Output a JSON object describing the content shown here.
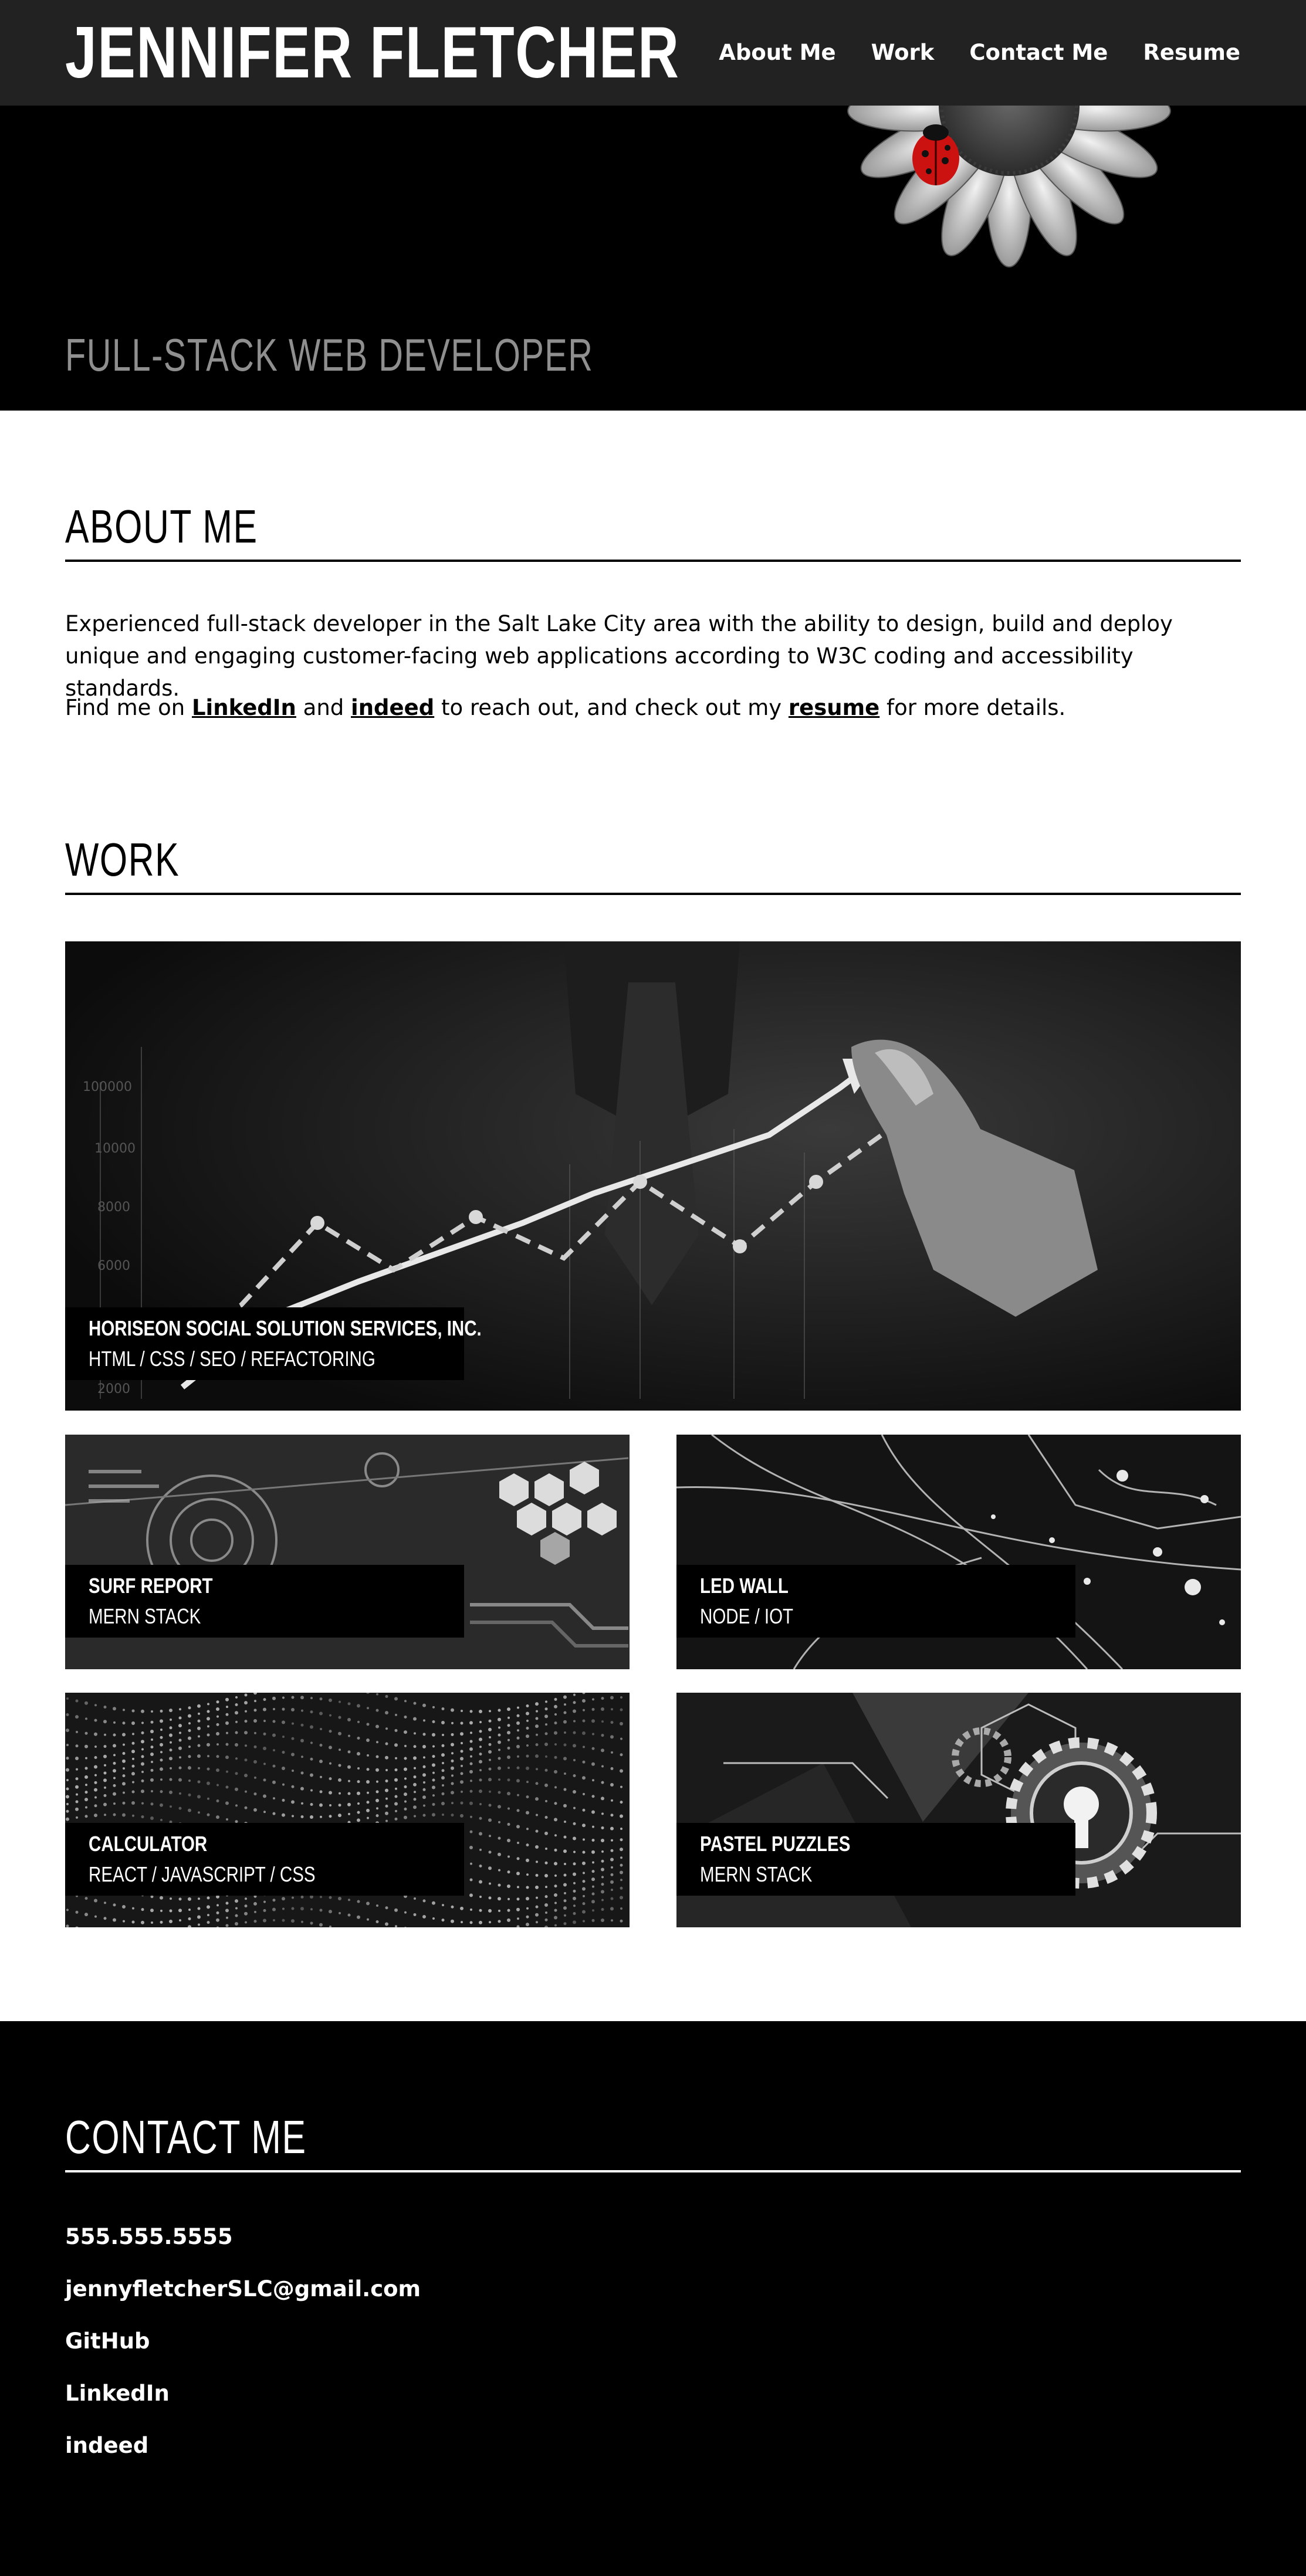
{
  "header": {
    "site_title": "JENNIFER FLETCHER",
    "nav": [
      "About Me",
      "Work",
      "Contact Me",
      "Resume"
    ]
  },
  "hero": {
    "subtitle": "FULL-STACK WEB DEVELOPER"
  },
  "about": {
    "title": "ABOUT ME",
    "paragraph1": "Experienced full-stack developer in the Salt Lake City area with the ability to design, build and deploy unique and engaging customer-facing web applications according to W3C coding and accessibility standards.",
    "p2_prefix": "Find me on ",
    "p2_link1": "LinkedIn",
    "p2_mid1": " and ",
    "p2_link2": "indeed",
    "p2_mid2": " to reach out, and check out my ",
    "p2_link3": "resume",
    "p2_suffix": " for more details."
  },
  "work": {
    "title": "WORK",
    "projects": [
      {
        "name": "HORISEON SOCIAL SOLUTION SERVICES, INC.",
        "stack": "HTML / CSS / SEO / REFACTORING",
        "image": "business-chart-image"
      },
      {
        "name": "SURF REPORT",
        "stack": "MERN STACK",
        "image": "tech-hexagon-image"
      },
      {
        "name": "LED WALL",
        "stack": "NODE / IOT",
        "image": "circuit-lights-image"
      },
      {
        "name": "CALCULATOR",
        "stack": "REACT / JAVASCRIPT / CSS",
        "image": "dot-wave-image"
      },
      {
        "name": "PASTEL PUZZLES",
        "stack": "MERN STACK",
        "image": "gears-lock-image"
      }
    ]
  },
  "contact": {
    "title": "CONTACT ME",
    "items": [
      "555.555.5555",
      "jennyfletcherSLC@gmail.com",
      "GitHub",
      "LinkedIn",
      "indeed"
    ]
  },
  "colors": {
    "topbar": "#222222",
    "hero_bg": "#000000",
    "hero_subtitle": "#8f8f8f",
    "accent_ladybug": "#cc1111"
  }
}
